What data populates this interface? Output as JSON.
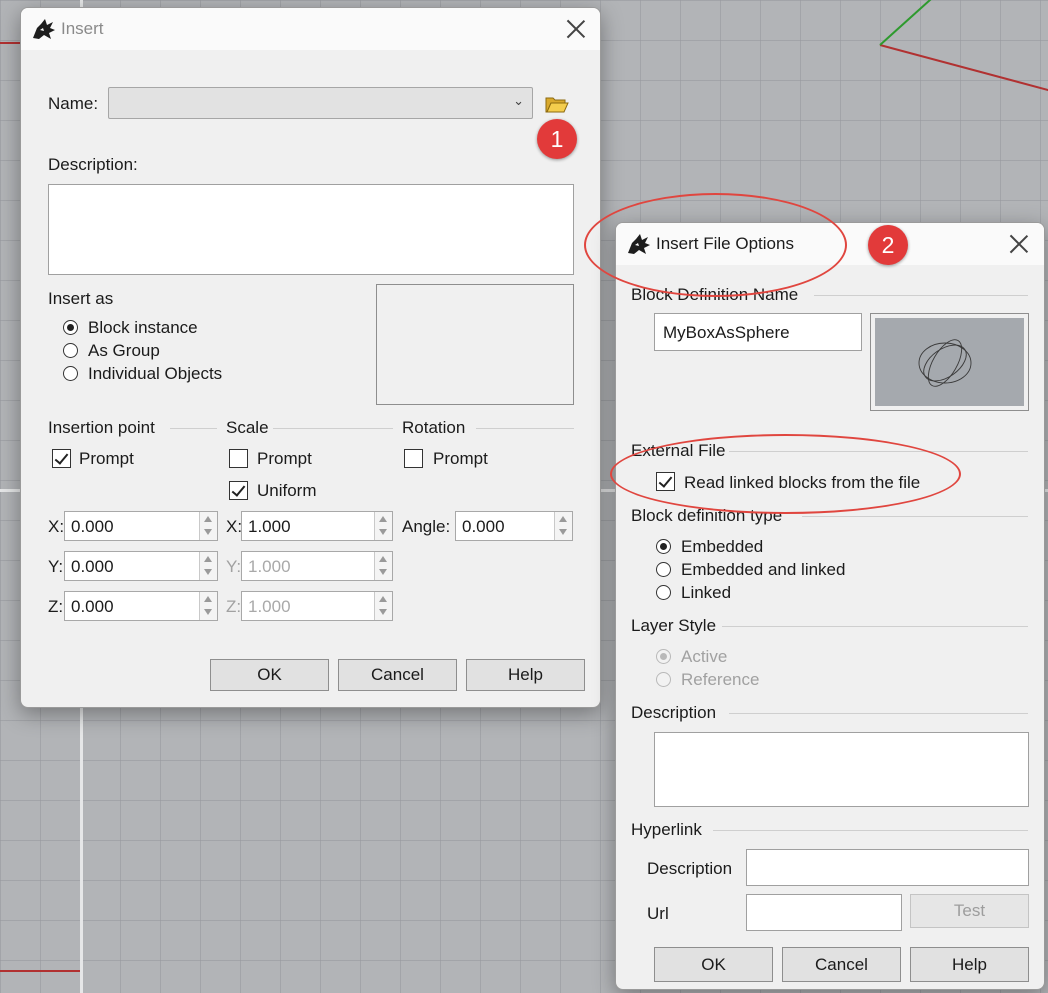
{
  "insert": {
    "title": "Insert",
    "name_label": "Name:",
    "name_value": "",
    "description_label": "Description:",
    "insert_as_label": "Insert as",
    "insert_as_options": [
      "Block instance",
      "As Group",
      "Individual Objects"
    ],
    "insert_as_selected": "Block instance",
    "insertion_point_label": "Insertion point",
    "scale_label": "Scale",
    "rotation_label": "Rotation",
    "prompt_label": "Prompt",
    "uniform_label": "Uniform",
    "insertion_prompt_checked": true,
    "scale_prompt_checked": false,
    "uniform_checked": true,
    "rotation_prompt_checked": false,
    "x_label": "X:",
    "y_label": "Y:",
    "z_label": "Z:",
    "angle_label": "Angle:",
    "point": {
      "x": "0.000",
      "y": "0.000",
      "z": "0.000"
    },
    "scale": {
      "x": "1.000",
      "y": "1.000",
      "z": "1.000"
    },
    "angle": "0.000",
    "ok": "OK",
    "cancel": "Cancel",
    "help": "Help"
  },
  "insert_file_options": {
    "title": "Insert File Options",
    "block_def_name_label": "Block Definition Name",
    "block_def_name_value": "MyBoxAsSphere",
    "external_file_label": "External File",
    "read_linked_label": "Read linked blocks from the file",
    "read_linked_checked": true,
    "block_def_type_label": "Block definition type",
    "block_def_types": [
      "Embedded",
      "Embedded and linked",
      "Linked"
    ],
    "block_def_type_selected": "Embedded",
    "layer_style_label": "Layer Style",
    "layer_styles": [
      "Active",
      "Reference"
    ],
    "layer_style_selected": "Active",
    "description_label": "Description",
    "hyperlink_label": "Hyperlink",
    "hyperlink_description_label": "Description",
    "url_label": "Url",
    "test": "Test",
    "ok": "OK",
    "cancel": "Cancel",
    "help": "Help"
  },
  "annotations": {
    "badge1": "1",
    "badge2": "2"
  },
  "colors": {
    "badge": "#e23a3a",
    "highlight_ellipse": "#e0463f"
  }
}
